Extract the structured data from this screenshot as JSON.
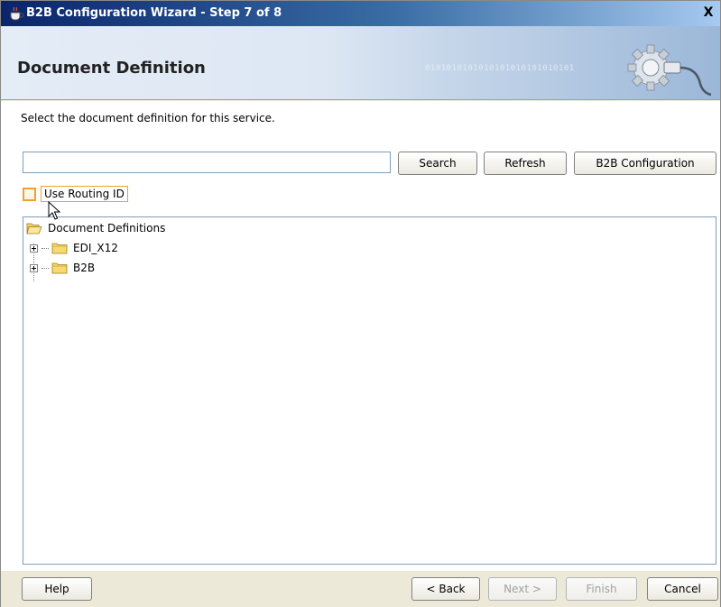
{
  "window": {
    "title": "B2B Configuration Wizard - Step 7 of 8",
    "close_label": "X"
  },
  "banner": {
    "heading": "Document Definition",
    "binary_text": "0101010101010101010101010101",
    "icon": "gear-plug-icon"
  },
  "main": {
    "instruction": "Select the document definition for this service.",
    "search": {
      "value": "",
      "placeholder": ""
    },
    "buttons": {
      "search": "Search",
      "refresh": "Refresh",
      "b2b_configuration": "B2B Configuration"
    },
    "routing": {
      "label": "Use Routing ID",
      "checked": false
    },
    "tree": {
      "root": "Document Definitions",
      "children": [
        {
          "label": "EDI_X12"
        },
        {
          "label": "B2B"
        }
      ]
    }
  },
  "footer": {
    "help": "Help",
    "back": "< Back",
    "next": "Next >",
    "finish": "Finish",
    "cancel": "Cancel"
  },
  "colors": {
    "focus_orange": "#f0a030",
    "title_bar": "#0a246a",
    "banner_blue": "#9bb7d8"
  }
}
